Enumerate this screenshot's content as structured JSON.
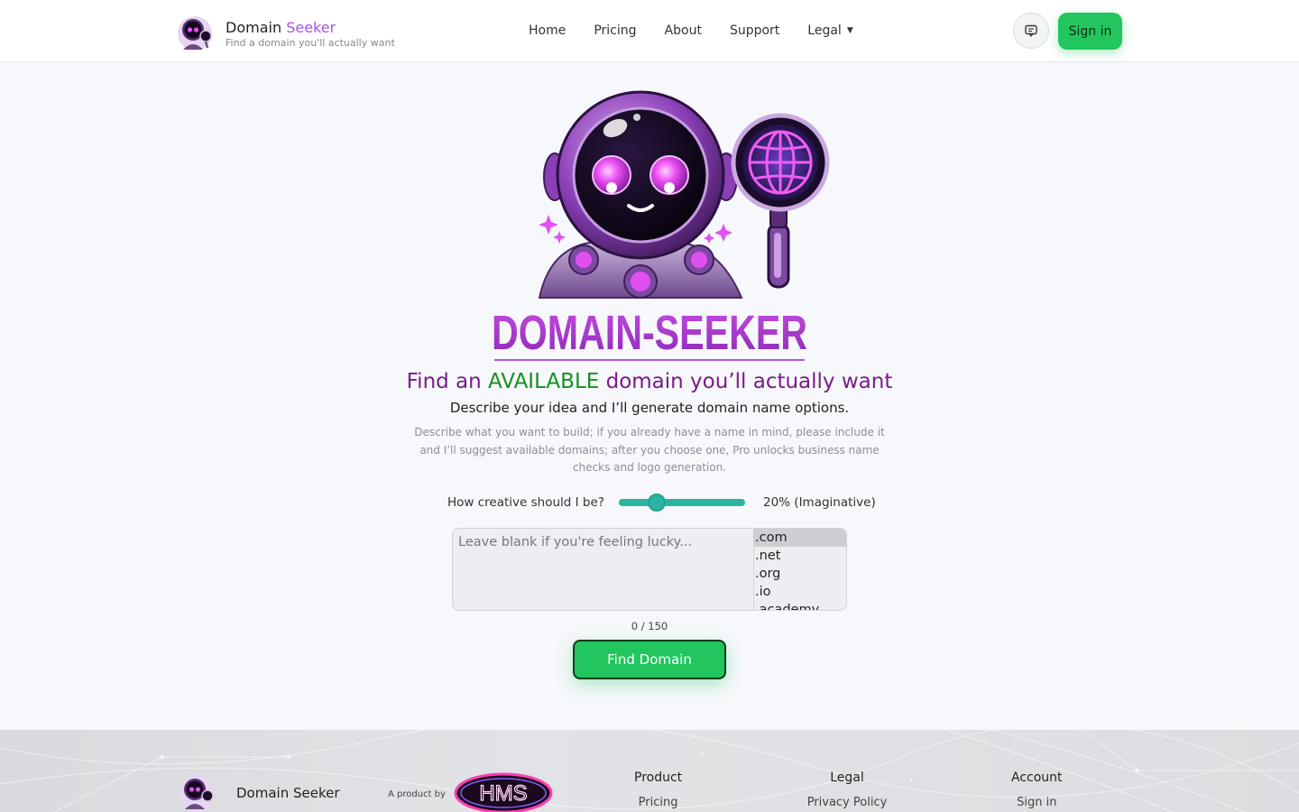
{
  "header": {
    "brand_name_part1": "Domain",
    "brand_name_part2": "Seeker",
    "brand_tagline": "Find a domain you'll actually want",
    "nav": [
      {
        "label": "Home"
      },
      {
        "label": "Pricing"
      },
      {
        "label": "About"
      },
      {
        "label": "Support"
      },
      {
        "label": "Legal",
        "has_dropdown": true
      }
    ],
    "feedback_icon": "message-square-icon",
    "signin_label": "Sign in"
  },
  "hero": {
    "wordmark": "DOMAIN-SEEKER",
    "headline_part1": "Find an ",
    "headline_highlight": "AVAILABLE",
    "headline_part2": " domain you’ll actually want",
    "subhead": "Describe your idea and I’ll generate domain name options.",
    "description": "Describe what you want to build; if you already have a name in mind, please include it and I’ll suggest available domains; after you choose one, Pro unlocks business name checks and logo generation.",
    "creativity_label": "How creative should I be?",
    "creativity_value_text": "20% (Imaginative)",
    "creativity_value": 0.2,
    "input_placeholder": "Leave blank if you're feeling lucky...",
    "tlds": [
      ".com",
      ".net",
      ".org",
      ".io",
      ".academy"
    ],
    "selected_tld": ".com",
    "counter": "0 / 150",
    "find_button": "Find Domain"
  },
  "footer": {
    "brand_name": "Domain Seeker",
    "product_by": "A product by",
    "company_logo_text": "HMS",
    "columns": [
      {
        "title": "Product",
        "first_link": "Pricing"
      },
      {
        "title": "Legal",
        "first_link": "Privacy Policy"
      },
      {
        "title": "Account",
        "first_link": "Sign in"
      }
    ]
  },
  "colors": {
    "accent_purple": "#a655e6",
    "headline_purple": "#7a1b8a",
    "available_green": "#158f1f",
    "button_green": "#22c55e",
    "slider_teal": "#2bb3a3"
  }
}
